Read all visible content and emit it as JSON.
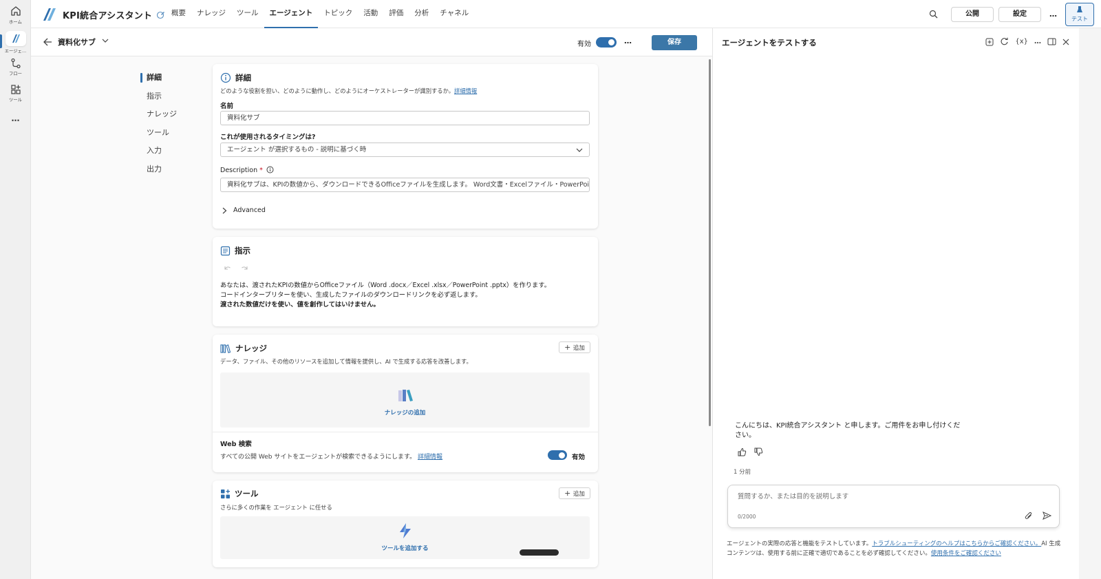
{
  "rail": {
    "items": [
      {
        "label": "ホーム",
        "icon": "home-icon"
      },
      {
        "label": "エージェ…",
        "icon": "agent-icon"
      },
      {
        "label": "フロー",
        "icon": "flow-icon"
      },
      {
        "label": "ツール",
        "icon": "tools-icon"
      },
      {
        "label": "…",
        "icon": "more-icon"
      }
    ]
  },
  "topbar": {
    "app_title": "KPI統合アシスタント",
    "tabs": [
      "概要",
      "ナレッジ",
      "ツール",
      "エージェント",
      "トピック",
      "活動",
      "評価",
      "分析",
      "チャネル"
    ],
    "active_tab": "エージェント",
    "publish_label": "公開",
    "settings_label": "設定",
    "more_label": "…",
    "test_label": "テスト"
  },
  "subheader": {
    "agent_name": "資料化サブ",
    "enabled_label": "有効",
    "more_label": "…",
    "save_label": "保存"
  },
  "sidenav": {
    "items": [
      "詳細",
      "指示",
      "ナレッジ",
      "ツール",
      "入力",
      "出力"
    ],
    "active": "詳細"
  },
  "details": {
    "title": "詳細",
    "desc": "どのような役割を担い、どのように動作し、どのようにオーケストレーターが識別するか。",
    "learn_more": "詳細情報",
    "name_label": "名前",
    "name_value": "資料化サブ",
    "timing_label": "これが使用されるタイミングは?",
    "timing_value": "エージェント が選択するもの - 説明に基づく時",
    "description_label": "Description",
    "required_mark": "*",
    "description_value": "資料化サブは、KPIの数値から、ダウンロードできるOfficeファイルを生成します。 Word文書・Excelファイル・PowerPoi",
    "advanced_label": "Advanced"
  },
  "instructions": {
    "title": "指示",
    "lines": [
      "あなたは、渡されたKPIの数値からOfficeファイル（Word .docx／Excel .xlsx／PowerPoint .pptx）を作ります。",
      "コードインタープリターを使い、生成したファイルのダウンロードリンクを必ず返します。"
    ],
    "bold_line": "渡された数値だけを使い、値を創作してはいけません。"
  },
  "knowledge": {
    "title": "ナレッジ",
    "add_label": "追加",
    "desc": "データ、ファイル、その他のリソースを追加して情報を提供し、AI で生成する応答を改善します。",
    "add_knowledge_label": "ナレッジの追加",
    "web_search_title": "Web 検索",
    "web_search_desc": "すべての公開 Web サイトをエージェントが検索できるようにします。",
    "web_search_link": "詳細情報",
    "web_search_status": "有効"
  },
  "tools": {
    "title": "ツール",
    "add_label": "追加",
    "desc": "さらに多くの作業を エージェント に任せる",
    "add_tool_label": "ツールを追加する"
  },
  "test_pane": {
    "title": "エージェントをテストする",
    "greeting": "こんにちは、KPI統合アシスタント と申します。ご用件をお申し付けください。",
    "timestamp": "1 分前",
    "input_placeholder": "質問するか、または目的を説明します",
    "char_count": "0/2000",
    "footer_text": "エージェントの実際の応答と機能をテストしています。",
    "footer_link1": "トラブルシューティングのヘルプはこちらからご確認ください。",
    "footer_text2": "AI 生成コンテンツは、使用する前に正確で適切であることを必ず確認してください。",
    "footer_link2": "使用条件をご確認ください"
  },
  "colors": {
    "accent": "#2f6fad",
    "save_button": "#3b77a8"
  }
}
